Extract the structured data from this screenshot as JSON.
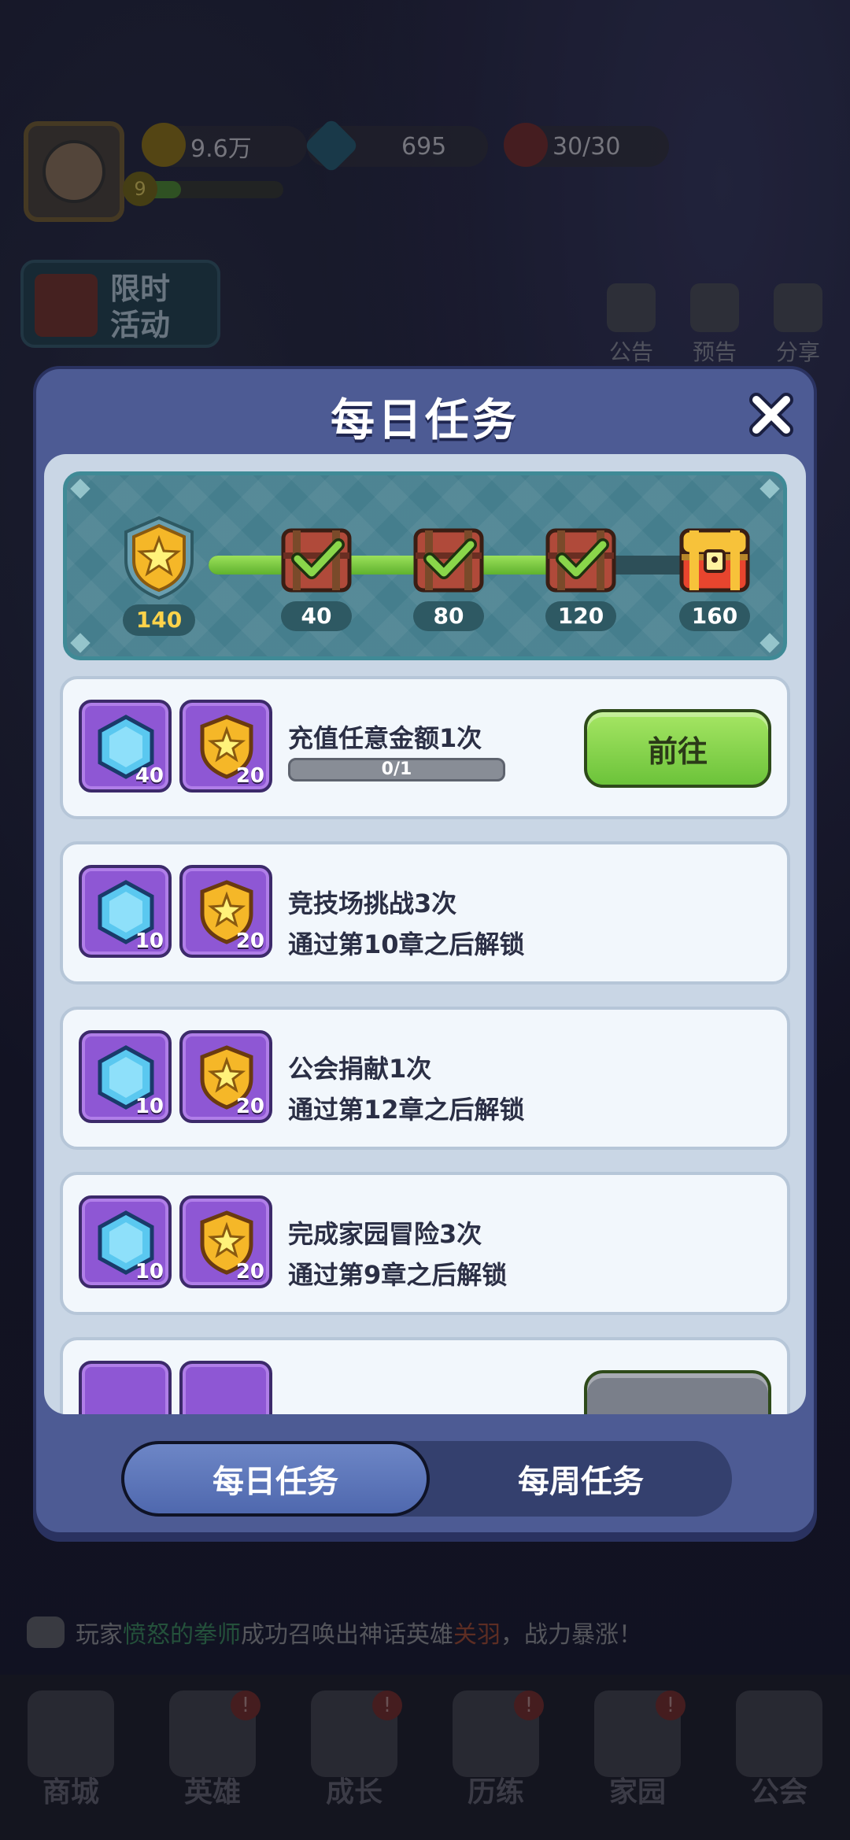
{
  "header": {
    "gold": "9.6万",
    "gems": "695",
    "stamina": "30/30",
    "level": "9",
    "event_button": "限时\n活动"
  },
  "side_buttons": [
    {
      "label": "公告",
      "icon": "megaphone-icon"
    },
    {
      "label": "预告",
      "icon": "scroll-icon"
    },
    {
      "label": "分享",
      "icon": "share-icon"
    }
  ],
  "modal": {
    "title": "每日任务",
    "close_icon": "close-icon",
    "progress": {
      "current_points": "140",
      "fill_fraction": 0.76,
      "milestones": [
        {
          "value": "40",
          "claimed": true
        },
        {
          "value": "80",
          "claimed": true
        },
        {
          "value": "120",
          "claimed": true
        },
        {
          "value": "160",
          "claimed": false
        }
      ]
    },
    "tasks": [
      {
        "name": "充值任意金额1次",
        "gem_reward": "40",
        "point_reward": "20",
        "progress_text": "0/1",
        "button": "前往"
      },
      {
        "name": "竞技场挑战3次",
        "gem_reward": "10",
        "point_reward": "20",
        "lock_text": "通过第10章之后解锁"
      },
      {
        "name": "公会捐献1次",
        "gem_reward": "10",
        "point_reward": "20",
        "lock_text": "通过第12章之后解锁"
      },
      {
        "name": "完成家园冒险3次",
        "gem_reward": "10",
        "point_reward": "20",
        "lock_text": "通过第9章之后解锁"
      }
    ],
    "tabs": [
      {
        "label": "每日任务",
        "active": true
      },
      {
        "label": "每周任务",
        "active": false
      }
    ]
  },
  "broadcast": {
    "prefix": "玩家",
    "player": "愤怒的拳师",
    "middle": "成功召唤出神话英雄",
    "hero": "关羽",
    "suffix": "，战力暴涨！"
  },
  "bottom_nav": [
    {
      "label": "商城",
      "icon": "shop-icon",
      "badge": false
    },
    {
      "label": "英雄",
      "icon": "hero-icon",
      "badge": true
    },
    {
      "label": "成长",
      "icon": "growth-icon",
      "badge": true
    },
    {
      "label": "历练",
      "icon": "map-icon",
      "badge": true
    },
    {
      "label": "家园",
      "icon": "castle-icon",
      "badge": true
    },
    {
      "label": "公会",
      "icon": "lock-icon",
      "badge": false
    }
  ],
  "colors": {
    "modal_bg": "#4d5b94",
    "progress_green": "#6cc33a",
    "reward_purple": "#8e57d4",
    "gold": "#ffd34a"
  }
}
